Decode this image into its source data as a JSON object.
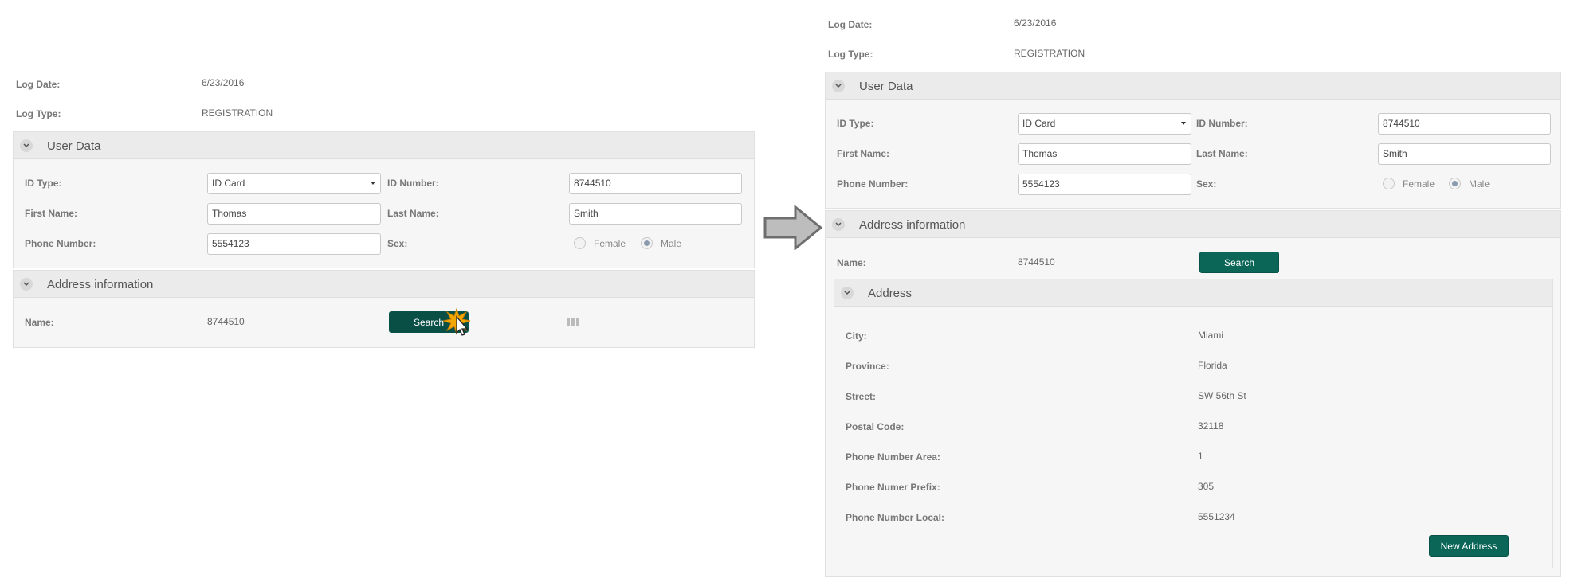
{
  "left": {
    "log_date_label": "Log Date:",
    "log_date_value": "6/23/2016",
    "log_type_label": "Log Type:",
    "log_type_value": "REGISTRATION",
    "user_data": {
      "title": "User Data",
      "id_type_label": "ID Type:",
      "id_type_value": "ID Card",
      "id_number_label": "ID Number:",
      "id_number_value": "8744510",
      "first_name_label": "First Name:",
      "first_name_value": "Thomas",
      "last_name_label": "Last Name:",
      "last_name_value": "Smith",
      "phone_label": "Phone Number:",
      "phone_value": "5554123",
      "sex_label": "Sex:",
      "female_label": "Female",
      "male_label": "Male"
    },
    "address_info": {
      "title": "Address information",
      "name_label": "Name:",
      "name_value": "8744510",
      "search_label": "Search"
    }
  },
  "right": {
    "log_date_label": "Log Date:",
    "log_date_value": "6/23/2016",
    "log_type_label": "Log Type:",
    "log_type_value": "REGISTRATION",
    "user_data": {
      "title": "User Data",
      "id_type_label": "ID Type:",
      "id_type_value": "ID Card",
      "id_number_label": "ID Number:",
      "id_number_value": "8744510",
      "first_name_label": "First Name:",
      "first_name_value": "Thomas",
      "last_name_label": "Last Name:",
      "last_name_value": "Smith",
      "phone_label": "Phone Number:",
      "phone_value": "5554123",
      "sex_label": "Sex:",
      "female_label": "Female",
      "male_label": "Male"
    },
    "address_info": {
      "title": "Address information",
      "name_label": "Name:",
      "name_value": "8744510",
      "search_label": "Search"
    },
    "address": {
      "title": "Address",
      "city_label": "City:",
      "city_value": "Miami",
      "province_label": "Province:",
      "province_value": "Florida",
      "street_label": "Street:",
      "street_value": "SW 56th St",
      "postal_label": "Postal Code:",
      "postal_value": "32118",
      "area_label": "Phone Number Area:",
      "area_value": "1",
      "prefix_label": "Phone Numer Prefix:",
      "prefix_value": "305",
      "local_label": "Phone Number Local:",
      "local_value": "5551234",
      "new_address_label": "New Address"
    }
  },
  "colors": {
    "button": "#0b6657",
    "panel_header": "#ebebeb",
    "panel_body": "#f6f6f6"
  }
}
